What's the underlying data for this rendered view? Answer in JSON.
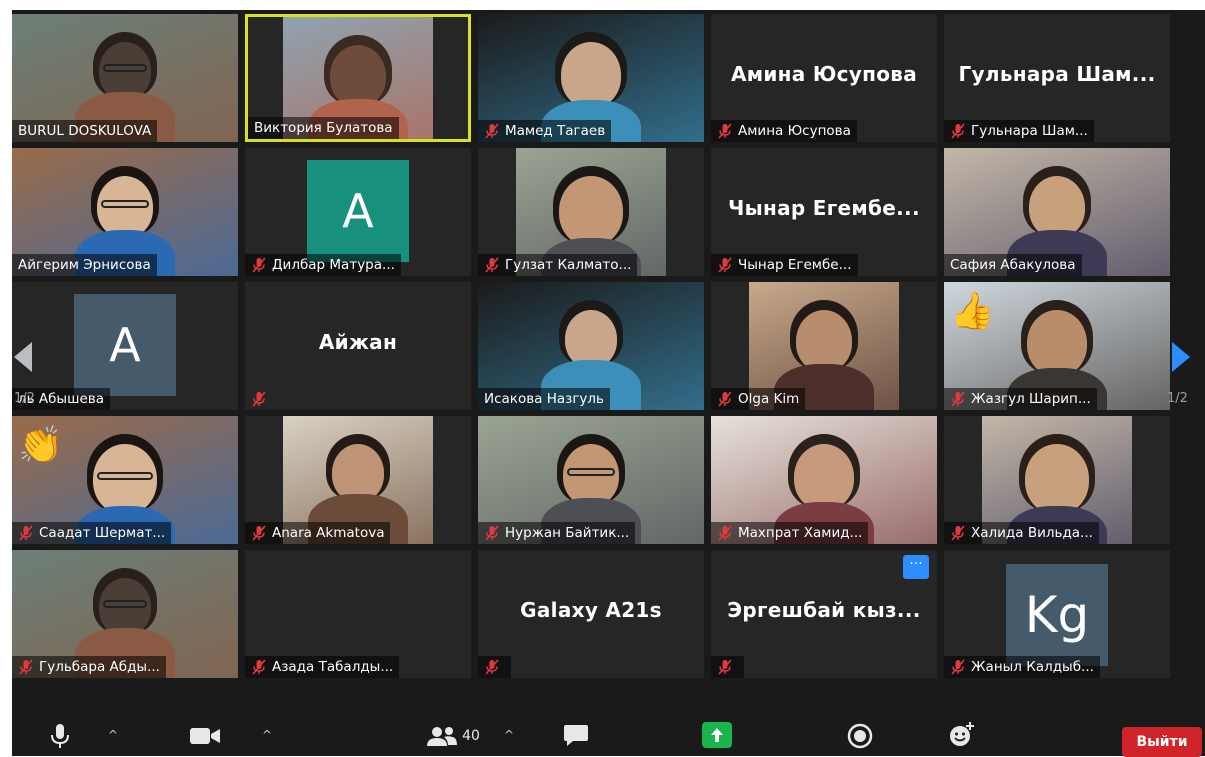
{
  "grid": {
    "rows": [
      [
        {
          "name": "BURUL DOSKULOVA",
          "muted": false,
          "video": true
        },
        {
          "name": "Виктория Булатова",
          "muted": false,
          "video": true,
          "active": true
        },
        {
          "name": "Мамед Тагаев",
          "muted": true,
          "video": true
        },
        {
          "name": "Амина Юсупова",
          "muted": true,
          "video": false,
          "big_name": "Амина Юсупова"
        },
        {
          "name": "Гульнара Шам...",
          "muted": true,
          "video": false,
          "big_name": "Гульнара  Шам..."
        }
      ],
      [
        {
          "name": "Айгерим Эрнисова",
          "muted": false,
          "video": true
        },
        {
          "name": "Дилбар Матура...",
          "muted": true,
          "video": false,
          "avatar": "A",
          "avatar_color": "#17917e"
        },
        {
          "name": "Гулзат Калмато...",
          "muted": true,
          "video": true
        },
        {
          "name": "Чынар Егембе...",
          "muted": true,
          "video": false,
          "big_name": "Чынар   Егембе..."
        },
        {
          "name": "Сафия Абакулова",
          "muted": false,
          "video": true
        }
      ],
      [
        {
          "name": "ль Абышева",
          "muted": false,
          "video": false,
          "avatar": "A",
          "avatar_color": "#455a6b"
        },
        {
          "name": "Айжан",
          "muted": true,
          "video": false,
          "big_name": "Айжан",
          "hide_bar": true
        },
        {
          "name": "Исакова Назгуль",
          "muted": false,
          "video": true
        },
        {
          "name": "Olga Kim",
          "muted": true,
          "video": true
        },
        {
          "name": "Жазгул Шарип...",
          "muted": true,
          "video": true,
          "reaction": "👍"
        }
      ],
      [
        {
          "name": "Саадат Шермат...",
          "muted": true,
          "video": true,
          "reaction": "👏"
        },
        {
          "name": "Anara Akmatova",
          "muted": true,
          "video": true
        },
        {
          "name": "Нуржан Байтик...",
          "muted": true,
          "video": true
        },
        {
          "name": "Махпрат Хамид...",
          "muted": true,
          "video": true
        },
        {
          "name": "Халида Вильда...",
          "muted": true,
          "video": true
        }
      ],
      [
        {
          "name": "Гульбара Абды...",
          "muted": true,
          "video": true
        },
        {
          "name": "Азада Табалды...",
          "muted": true,
          "video": false
        },
        {
          "name": "",
          "muted": true,
          "video": false,
          "big_name": "Galaxy A21s"
        },
        {
          "name": "",
          "muted": true,
          "video": false,
          "big_name": "Эргешбай  кыз...",
          "more": true
        },
        {
          "name": "Жаныл Калдыб...",
          "muted": true,
          "video": false,
          "avatar": "Kg",
          "avatar_color": "#455a6b"
        }
      ]
    ]
  },
  "pager": {
    "left": "1/2",
    "right": "1/2"
  },
  "toolbar": {
    "participants_count": "40",
    "more_glyph": "···",
    "caret": "^",
    "leave_label": "Выйти"
  },
  "colors": {
    "accent": "#2d8cff",
    "active_border": "#d9e022",
    "leave": "#d1232a",
    "muted_icon": "#e0393e",
    "share": "#1bb34c"
  }
}
